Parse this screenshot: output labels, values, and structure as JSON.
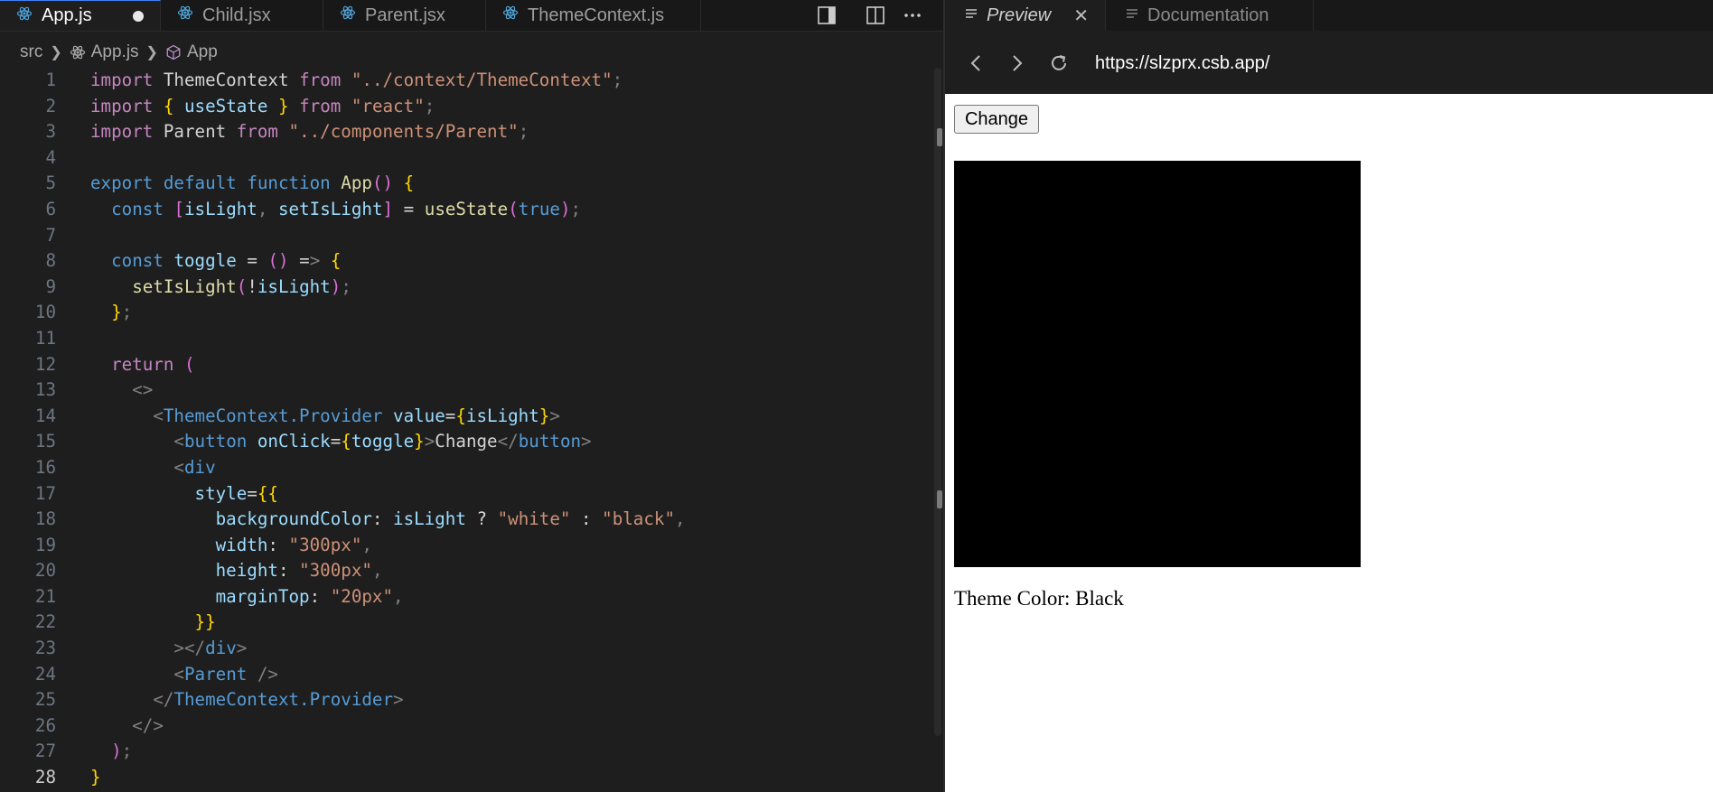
{
  "editor_tabs": [
    {
      "label": "App.js",
      "active": true,
      "modified": true
    },
    {
      "label": "Child.jsx"
    },
    {
      "label": "Parent.jsx"
    },
    {
      "label": "ThemeContext.js"
    }
  ],
  "editor_actions": [
    "toggle-sidebar-icon",
    "split-editor-icon",
    "more-actions-icon"
  ],
  "breadcrumbs": [
    "src",
    "App.js",
    "App"
  ],
  "line_numbers": [
    "1",
    "2",
    "3",
    "4",
    "5",
    "6",
    "7",
    "8",
    "9",
    "10",
    "11",
    "12",
    "13",
    "14",
    "15",
    "16",
    "17",
    "18",
    "19",
    "20",
    "21",
    "22",
    "23",
    "24",
    "25",
    "26",
    "27",
    "28"
  ],
  "code_lines": [
    "import ThemeContext from \"../context/ThemeContext\";",
    "import { useState } from \"react\";",
    "import Parent from \"../components/Parent\";",
    "",
    "export default function App() {",
    "  const [isLight, setIsLight] = useState(true);",
    "",
    "  const toggle = () => {",
    "    setIsLight(!isLight);",
    "  };",
    "",
    "  return (",
    "    <>",
    "      <ThemeContext.Provider value={isLight}>",
    "        <button onClick={toggle}>Change</button>",
    "        <div",
    "          style={{",
    "            backgroundColor: isLight ? \"white\" : \"black\",",
    "            width: \"300px\",",
    "            height: \"300px\",",
    "            marginTop: \"20px\",",
    "          }}",
    "        ></div>",
    "        <Parent />",
    "      </ThemeContext.Provider>",
    "    </>",
    "  );",
    "}"
  ],
  "preview_tabs": [
    {
      "label": "Preview",
      "active": true
    },
    {
      "label": "Documentation"
    }
  ],
  "browser": {
    "url": "https://slzprx.csb.app/"
  },
  "preview": {
    "button_label": "Change",
    "box_color": "#000000",
    "theme_text": "Theme Color: Black"
  },
  "colors": {
    "editor_bg": "#1e1e1e",
    "tab_active_border": "#3c82f6"
  }
}
